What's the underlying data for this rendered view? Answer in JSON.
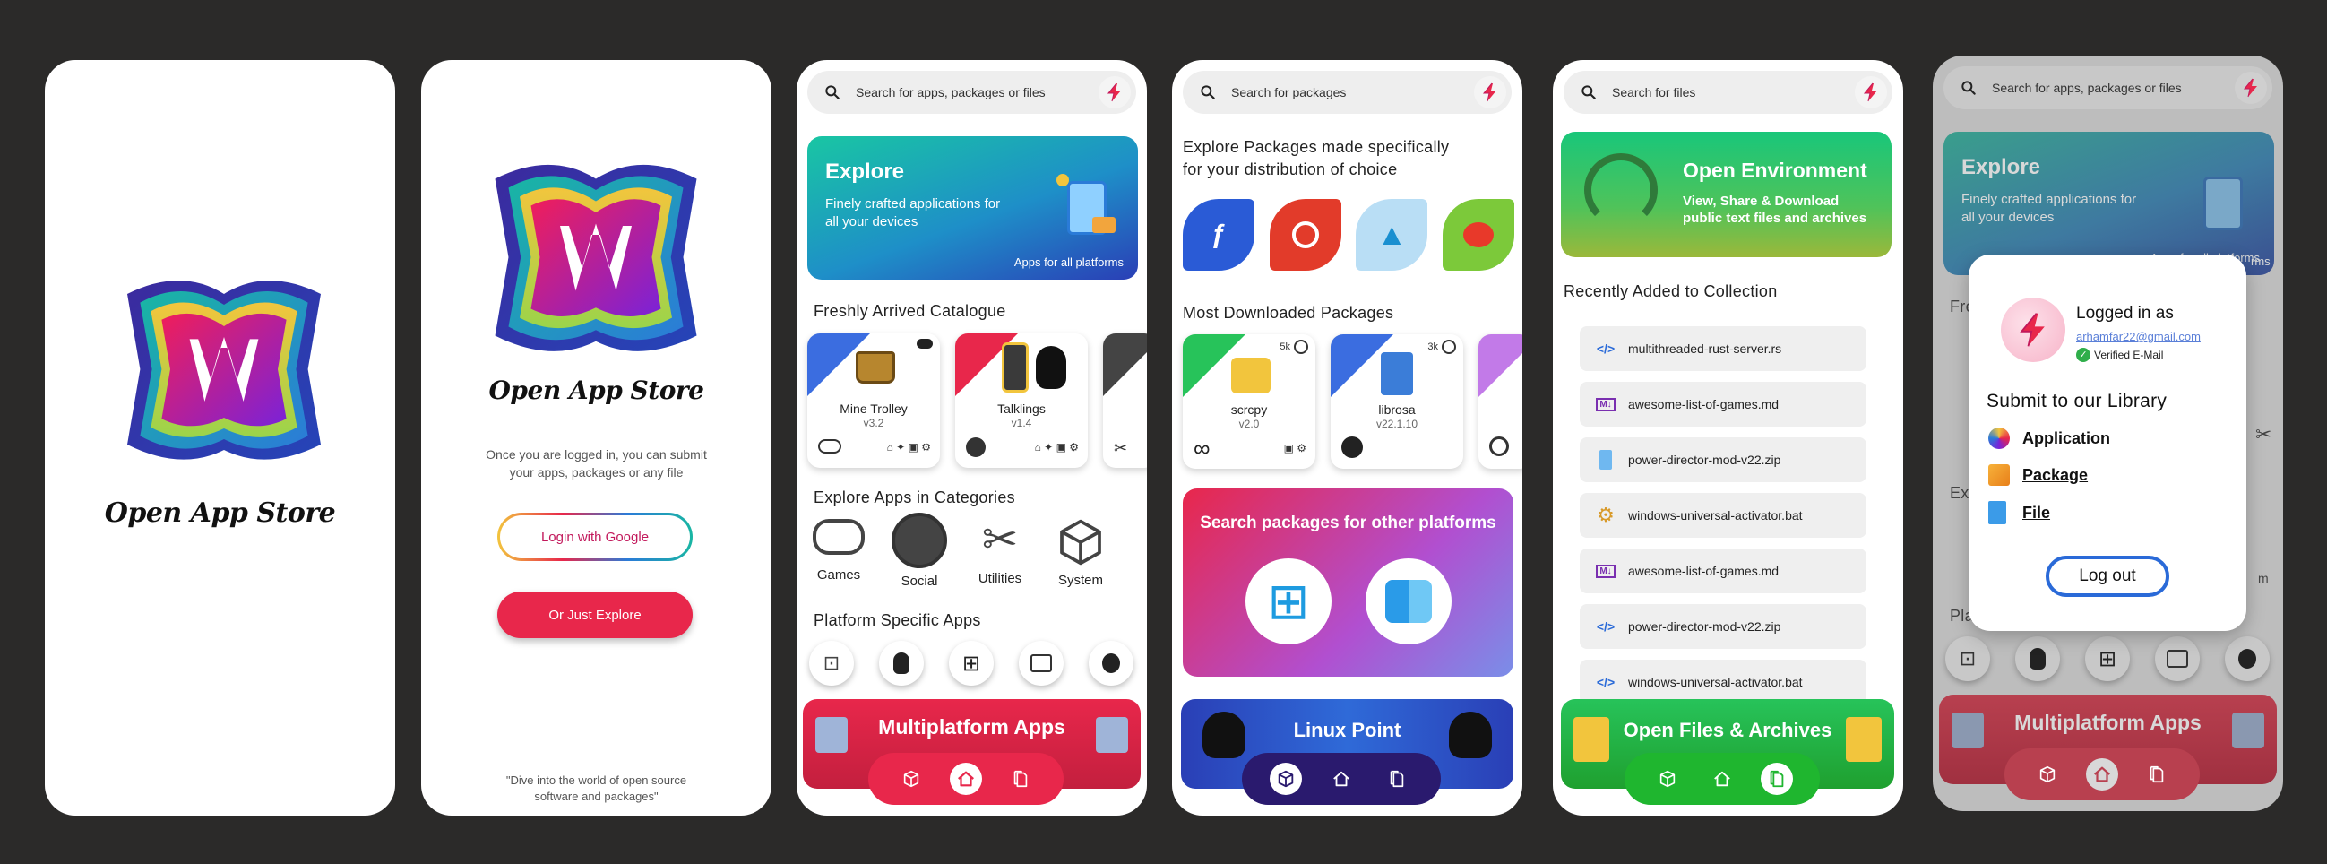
{
  "colors": {
    "background": "#2b2a29",
    "accent_red": "#e8274b",
    "nav_red": "#e8274b",
    "nav_purple": "#2a1a6e",
    "nav_green": "#1fb62f"
  },
  "splash": {
    "app_name": "Open App Store"
  },
  "login": {
    "app_name": "Open App Store",
    "message": "Once you are logged in, you can submit your apps, packages or any file",
    "google_button": "Login with Google",
    "explore_button": "Or Just Explore",
    "quote": "\"Dive into the world of open source software and packages\""
  },
  "home": {
    "search_placeholder": "Search for apps, packages or files",
    "banner": {
      "title": "Explore",
      "subtitle": "Finely crafted applications for all your devices",
      "tag": "Apps for all platforms"
    },
    "fresh_title": "Freshly Arrived Catalogue",
    "apps": [
      {
        "name": "Mine Trolley",
        "version": "v3.2"
      },
      {
        "name": "Talklings",
        "version": "v1.4"
      }
    ],
    "categories_title": "Explore Apps in Categories",
    "categories": [
      "Games",
      "Social",
      "Utilities",
      "System"
    ],
    "platform_title": "Platform Specific Apps",
    "multiplatform": "Multiplatform Apps"
  },
  "packages": {
    "search_placeholder": "Search for packages",
    "heading": "Explore Packages made specifically for your distribution of choice",
    "most_downloaded_title": "Most Downloaded Packages",
    "items": [
      {
        "name": "scrcpy",
        "version": "v2.0",
        "downloads": "5k"
      },
      {
        "name": "librosa",
        "version": "v22.1.10",
        "downloads": "3k"
      }
    ],
    "other_platforms": "Search packages for other platforms",
    "linux_point": "Linux Point"
  },
  "files": {
    "search_placeholder": "Search for files",
    "banner": {
      "title": "Open Environment",
      "subtitle": "View, Share & Download public text files and archives"
    },
    "recent_title": "Recently Added to Collection",
    "items": [
      {
        "name": "multithreaded-rust-server.rs",
        "icon": "code-icon"
      },
      {
        "name": "awesome-list-of-games.md",
        "icon": "markdown-icon"
      },
      {
        "name": "power-director-mod-v22.zip",
        "icon": "zip-icon"
      },
      {
        "name": "windows-universal-activator.bat",
        "icon": "gear-icon"
      },
      {
        "name": "awesome-list-of-games.md",
        "icon": "markdown-icon"
      },
      {
        "name": "power-director-mod-v22.zip",
        "icon": "code-icon"
      },
      {
        "name": "windows-universal-activator.bat",
        "icon": "code-icon"
      }
    ],
    "open_files": "Open Files & Archives"
  },
  "profile": {
    "search_placeholder": "Search for apps, packages or files",
    "banner": {
      "title": "Explore",
      "subtitle": "Finely crafted applications for all your devices",
      "tag": "Apps for all platforms"
    },
    "logged_in_as": "Logged in as",
    "email": "arhamfar22@gmail.com",
    "verified": "Verified E-Mail",
    "submit_title": "Submit to our Library",
    "submit_options": [
      "Application",
      "Package",
      "File"
    ],
    "logout": "Log out",
    "multiplatform": "Multiplatform Apps",
    "fragment_fre": "Fre",
    "fragment_ex": "Ex",
    "fragment_pla": "Pla",
    "fragment_m": "m",
    "fragment_rms": "rms"
  }
}
